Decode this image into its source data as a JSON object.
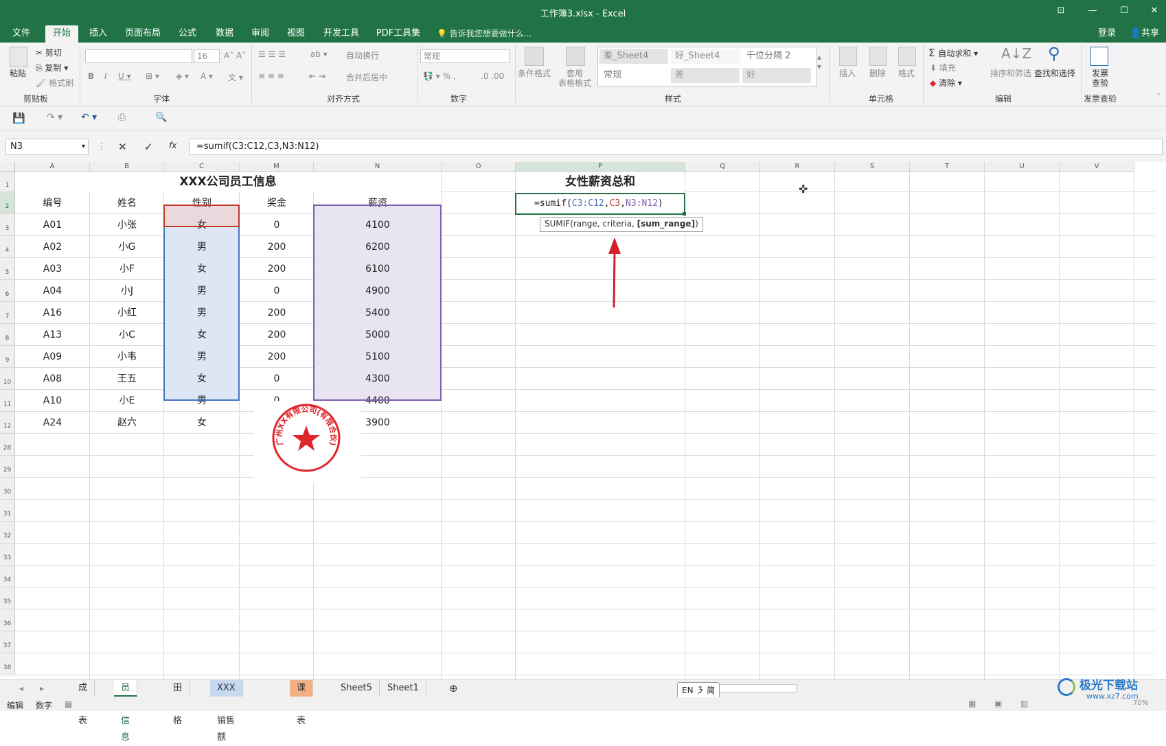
{
  "window": {
    "title": "工作簿3.xlsx - Excel",
    "login": "登录",
    "share": "共享"
  },
  "ribbon_tabs": [
    "文件",
    "开始",
    "插入",
    "页面布局",
    "公式",
    "数据",
    "审阅",
    "视图",
    "开发工具",
    "PDF工具集"
  ],
  "active_tab": "开始",
  "tell_me": "告诉我您想要做什么...",
  "ribbon": {
    "clipboard": {
      "paste": "粘贴",
      "cut": "剪切",
      "copy": "复制",
      "format_painter": "格式刷",
      "label": "剪贴板"
    },
    "font": {
      "size": "16",
      "label": "字体"
    },
    "alignment": {
      "wrap": "自动换行",
      "merge": "合并后居中",
      "label": "对齐方式"
    },
    "number": {
      "format": "常规",
      "label": "数字"
    },
    "styles": {
      "conditional": "条件格式",
      "table_format": "套用\n表格格式",
      "gallery": [
        "差_Sheet4",
        "好_Sheet4",
        "千位分隔 2",
        "常规",
        "差",
        "好"
      ],
      "label": "样式"
    },
    "cells": {
      "insert": "插入",
      "delete": "删除",
      "format": "格式",
      "label": "单元格"
    },
    "editing": {
      "autosum": "自动求和",
      "fill": "填充",
      "clear": "清除",
      "sort_filter": "排序和筛选",
      "find_select": "查找和选择",
      "label": "编辑"
    },
    "invoice": {
      "check": "发票\n查验",
      "label": "发票查验"
    }
  },
  "formula_bar": {
    "name_box": "N3",
    "fx": "fx",
    "formula": "=sumif(C3:C12,C3,N3:N12)"
  },
  "grid": {
    "columns": [
      "A",
      "B",
      "C",
      "M",
      "N",
      "O",
      "P",
      "Q",
      "R",
      "S",
      "T",
      "U",
      "V"
    ],
    "rows": [
      "1",
      "2",
      "3",
      "4",
      "5",
      "6",
      "7",
      "8",
      "9",
      "10",
      "11",
      "12",
      "28",
      "29",
      "30",
      "31",
      "32",
      "33",
      "34",
      "35",
      "36",
      "37",
      "38"
    ],
    "table_title": "XXX公司员工信息",
    "headers": [
      "编号",
      "姓名",
      "性别",
      "奖金",
      "薪资"
    ],
    "records": [
      [
        "A01",
        "小张",
        "女",
        "0",
        "4100"
      ],
      [
        "A02",
        "小G",
        "男",
        "200",
        "6200"
      ],
      [
        "A03",
        "小F",
        "女",
        "200",
        "6100"
      ],
      [
        "A04",
        "小J",
        "男",
        "0",
        "4900"
      ],
      [
        "A16",
        "小红",
        "男",
        "200",
        "5400"
      ],
      [
        "A13",
        "小C",
        "女",
        "200",
        "5000"
      ],
      [
        "A09",
        "小韦",
        "男",
        "200",
        "5100"
      ],
      [
        "A08",
        "王五",
        "女",
        "0",
        "4300"
      ],
      [
        "A10",
        "小E",
        "男",
        "0",
        "4400"
      ],
      [
        "A24",
        "赵六",
        "女",
        "0",
        "3900"
      ]
    ],
    "p_title": "女性薪资总和",
    "p_edit": {
      "prefix": "=sumif(",
      "arg1": "C3:C12",
      "comma1": ",",
      "arg2": "C3",
      "comma2": ",",
      "arg3": "N3:N12",
      "suffix": ")"
    },
    "tooltip": {
      "text": "SUMIF(range, criteria, ",
      "bold": "[sum_range]",
      "end": ")"
    },
    "stamp_text": "广州XX有限公司(有限合伙)"
  },
  "sheet_tabs": [
    {
      "label": "成绩表",
      "bg": ""
    },
    {
      "label": "员工信息",
      "bg": "#ffffff"
    },
    {
      "label": "田字格",
      "bg": ""
    },
    {
      "label": "XXX公司销售额",
      "bg": "#c6d9f0"
    },
    {
      "label": "课程表",
      "bg": "#f4b084"
    },
    {
      "label": "Sheet5",
      "bg": ""
    },
    {
      "label": "Sheet1",
      "bg": ""
    }
  ],
  "active_sheet": "员工信息",
  "status": {
    "mode": "编辑",
    "num": "数字",
    "ime": "EN ㇋ 简",
    "watermark": "极光下载站",
    "watermark_url": "www.xz7.com",
    "zoom": "70%"
  },
  "colors": {
    "excel_green": "#217346",
    "range_blue": "#4472c4",
    "range_red": "#c0392b",
    "range_purple": "#7f5fb3",
    "arrow_red": "#d4202a"
  }
}
